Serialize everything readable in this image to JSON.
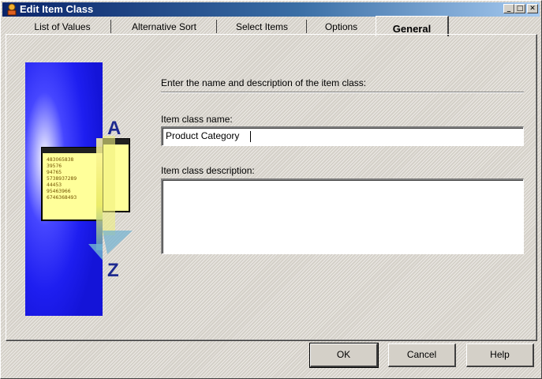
{
  "window": {
    "title": "Edit Item Class",
    "minimize_glyph": "_",
    "restore_glyph": "□",
    "close_glyph": "✕"
  },
  "tabs": [
    {
      "label": "List of Values",
      "active": false
    },
    {
      "label": "Alternative Sort",
      "active": false
    },
    {
      "label": "Select Items",
      "active": false
    },
    {
      "label": "Options",
      "active": false
    },
    {
      "label": "General",
      "active": true
    }
  ],
  "general": {
    "instruction": "Enter the name and description of the item class:",
    "name_label": "Item class name:",
    "name_value": "Product Category",
    "description_label": "Item class description:",
    "description_value": ""
  },
  "illustration": {
    "letter_top": "A",
    "letter_bottom": "Z",
    "numbers": [
      "483065838",
      "39576",
      "94765",
      "5738937289",
      "44453",
      "95463966",
      "6746368493"
    ]
  },
  "buttons": {
    "ok": "OK",
    "cancel": "Cancel",
    "help": "Help"
  },
  "colors": {
    "titlebar_start": "#0a246a",
    "titlebar_end": "#a6caf0",
    "image_blue": "#1e1ef0",
    "face": "#d4d0c8"
  }
}
